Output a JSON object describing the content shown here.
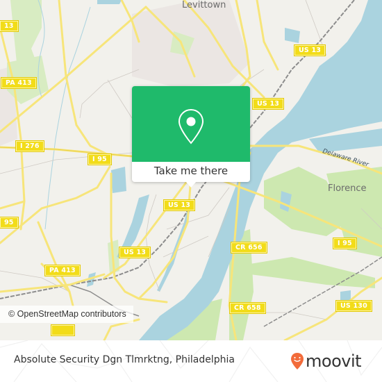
{
  "map": {
    "place_labels": {
      "levittown": "Levittown",
      "florence": "Florence"
    },
    "water_labels": {
      "delaware_river": "Delaware River"
    },
    "road_shields": [
      {
        "id": "us13-topleft",
        "label": "13"
      },
      {
        "id": "pa413-left",
        "label": "PA 413"
      },
      {
        "id": "i276",
        "label": "I 276"
      },
      {
        "id": "i95-upper",
        "label": "I 95"
      },
      {
        "id": "us13-top-right",
        "label": "US 13"
      },
      {
        "id": "us13-mid",
        "label": "US 13"
      },
      {
        "id": "us13-center",
        "label": "US 13"
      },
      {
        "id": "i95-left",
        "label": "95"
      },
      {
        "id": "us13-lower",
        "label": "US 13"
      },
      {
        "id": "pa413-lower",
        "label": "PA 413"
      },
      {
        "id": "cr656",
        "label": "CR 656"
      },
      {
        "id": "i95-right",
        "label": "I 95"
      },
      {
        "id": "cr658",
        "label": "CR 658"
      },
      {
        "id": "us130",
        "label": "US 130"
      }
    ],
    "attribution": "© OpenStreetMap contributors",
    "colors": {
      "land": "#f2f1ec",
      "water": "#aad3df",
      "park": "#cde8b0",
      "road": "#f7e57a",
      "shield": "#f2dc19"
    }
  },
  "popup": {
    "icon": "map-pin-icon",
    "button_label": "Take me there",
    "color": "#1fba6b"
  },
  "footer": {
    "title": "Absolute Security Dgn Tlmrktng, Philadelphia",
    "brand": "moovit",
    "brand_color": "#f26b3a"
  }
}
